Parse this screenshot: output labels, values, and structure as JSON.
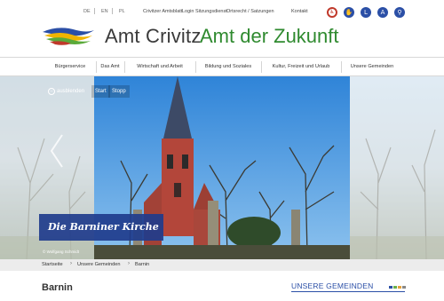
{
  "languages": [
    "DE",
    "EN",
    "PL"
  ],
  "top_links": [
    "Crivitzer Amtsblatt",
    "Login Sitzungsdienst",
    "Ortsrecht / Satzungen",
    "Kontakt"
  ],
  "top_icons": [
    "accessibility-icon",
    "sign-language-icon",
    "easy-language-icon",
    "text-size-icon",
    "search-icon"
  ],
  "top_icon_glyphs": [
    "♿",
    "✋",
    "L",
    "A",
    "⚲"
  ],
  "brand": {
    "part1": "Amt Crivitz",
    "part2": "Amt der Zukunft"
  },
  "nav": [
    "Bürgerservice",
    "Das Amt",
    "Wirtschaft und Arbeit",
    "Bildung und Soziales",
    "Kultur, Freizeit und Urlaub",
    "Unsere Gemeinden"
  ],
  "slider": {
    "hide_label": "ausblenden",
    "start_label": "Start",
    "stop_label": "Stopp",
    "caption": "Die Barniner Kirche",
    "credit": "© Wolfgang Schmidt"
  },
  "breadcrumb": [
    "Startseite",
    "Unsere Gemeinden",
    "Barnin"
  ],
  "page_title": "Barnin",
  "sidebar_heading": "UNSERE GEMEINDEN",
  "colors": {
    "brand_blue": "#2b4fa6",
    "brand_green": "#2f8a2f",
    "caption_bg": "#203c8c",
    "strip": [
      "#2b4fa6",
      "#6ab04c",
      "#e6a23c",
      "#888888"
    ]
  }
}
